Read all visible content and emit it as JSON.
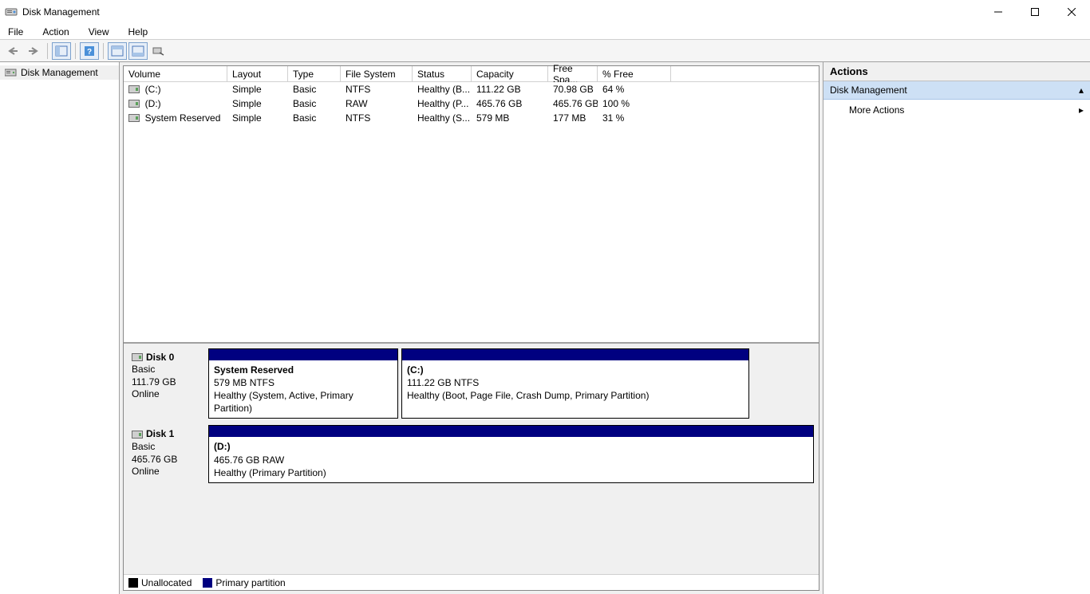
{
  "window": {
    "title": "Disk Management"
  },
  "menubar": {
    "file": "File",
    "action": "Action",
    "view": "View",
    "help": "Help"
  },
  "tree": {
    "root": "Disk Management"
  },
  "volume_table": {
    "headers": {
      "volume": "Volume",
      "layout": "Layout",
      "type": "Type",
      "fs": "File System",
      "status": "Status",
      "capacity": "Capacity",
      "free": "Free Spa...",
      "pct": "% Free"
    },
    "rows": [
      {
        "volume": "(C:)",
        "layout": "Simple",
        "type": "Basic",
        "fs": "NTFS",
        "status": "Healthy (B...",
        "capacity": "111.22 GB",
        "free": "70.98 GB",
        "pct": "64 %"
      },
      {
        "volume": "(D:)",
        "layout": "Simple",
        "type": "Basic",
        "fs": "RAW",
        "status": "Healthy (P...",
        "capacity": "465.76 GB",
        "free": "465.76 GB",
        "pct": "100 %"
      },
      {
        "volume": "System Reserved",
        "layout": "Simple",
        "type": "Basic",
        "fs": "NTFS",
        "status": "Healthy (S...",
        "capacity": "579 MB",
        "free": "177 MB",
        "pct": "31 %"
      }
    ]
  },
  "disks": {
    "d0": {
      "name": "Disk 0",
      "type": "Basic",
      "size": "111.79 GB",
      "state": "Online",
      "p0": {
        "name": "System Reserved",
        "detail": "579 MB NTFS",
        "status": "Healthy (System, Active, Primary Partition)"
      },
      "p1": {
        "name": "(C:)",
        "detail": "111.22 GB NTFS",
        "status": "Healthy (Boot, Page File, Crash Dump, Primary Partition)"
      }
    },
    "d1": {
      "name": "Disk 1",
      "type": "Basic",
      "size": "465.76 GB",
      "state": "Online",
      "p0": {
        "name": "(D:)",
        "detail": "465.76 GB RAW",
        "status": "Healthy (Primary Partition)"
      }
    }
  },
  "legend": {
    "unallocated": "Unallocated",
    "primary": "Primary partition"
  },
  "actions": {
    "header": "Actions",
    "section": "Disk Management",
    "more": "More Actions"
  }
}
